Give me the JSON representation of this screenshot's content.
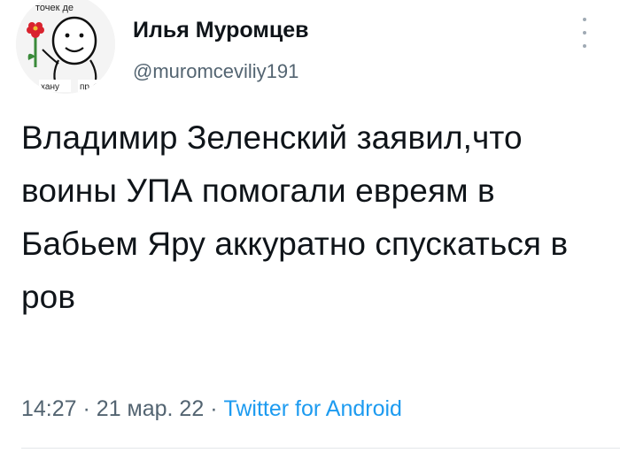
{
  "tweet": {
    "author": {
      "name": "Илья Муромцев",
      "handle": "@muromceviliy191",
      "avatar": {
        "icon": "meme-face-avatar-icon",
        "top_text": "точек де",
        "bottom_left_text": "хану",
        "bottom_right_text": "пр"
      }
    },
    "text": "Владимир Зеленский заявил,что воины УПА помогали евреям в Бабьем Яру аккуратно спускаться в ров",
    "time": "14:27",
    "separator": "·",
    "date": "21 мар. 22",
    "source": "Twitter for Android",
    "more_icon": "more-vertical-icon"
  },
  "colors": {
    "text": "#0f1419",
    "secondary": "#536471",
    "link": "#1d9bf0",
    "flower": "#d9232e"
  }
}
